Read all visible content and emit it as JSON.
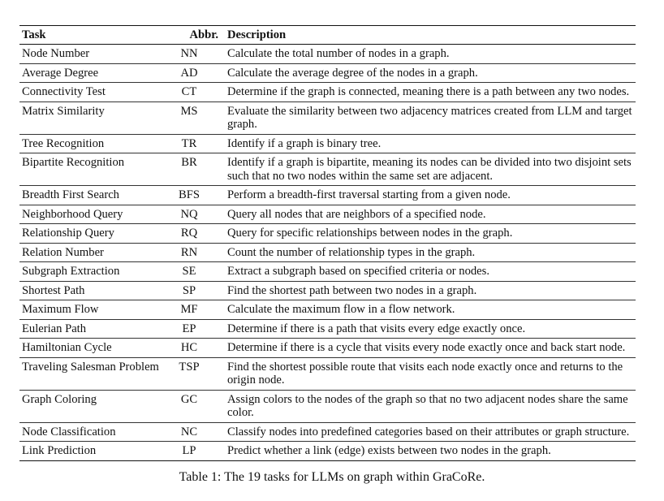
{
  "table": {
    "headers": {
      "task": "Task",
      "abbr": "Abbr.",
      "description": "Description"
    },
    "rows": [
      {
        "task": "Node Number",
        "abbr": "NN",
        "description": "Calculate the total number of nodes in a graph."
      },
      {
        "task": "Average Degree",
        "abbr": "AD",
        "description": "Calculate the average degree of the nodes in a graph."
      },
      {
        "task": "Connectivity Test",
        "abbr": "CT",
        "description": "Determine if the graph is connected, meaning there is a path between any two nodes."
      },
      {
        "task": "Matrix Similarity",
        "abbr": "MS",
        "description": "Evaluate the similarity between two adjacency matrices created from LLM and target graph."
      },
      {
        "task": "Tree Recognition",
        "abbr": "TR",
        "description": "Identify if a graph is binary tree."
      },
      {
        "task": "Bipartite Recognition",
        "abbr": "BR",
        "description": "Identify if a graph is bipartite, meaning its nodes can be divided into two disjoint sets such that no two nodes within the same set are adjacent."
      },
      {
        "task": "Breadth First Search",
        "abbr": "BFS",
        "description": "Perform a breadth-first traversal starting from a given node."
      },
      {
        "task": "Neighborhood Query",
        "abbr": "NQ",
        "description": "Query all nodes that are neighbors of a specified node."
      },
      {
        "task": "Relationship Query",
        "abbr": "RQ",
        "description": "Query for specific relationships between nodes in the graph."
      },
      {
        "task": "Relation Number",
        "abbr": "RN",
        "description": "Count the number of relationship types in the graph."
      },
      {
        "task": "Subgraph Extraction",
        "abbr": "SE",
        "description": "Extract a subgraph based on specified criteria or nodes."
      },
      {
        "task": "Shortest Path",
        "abbr": "SP",
        "description": "Find the shortest path between two nodes in a graph."
      },
      {
        "task": "Maximum Flow",
        "abbr": "MF",
        "description": "Calculate the maximum flow in a flow network."
      },
      {
        "task": "Eulerian Path",
        "abbr": "EP",
        "description": "Determine if there is a path that visits every edge exactly once."
      },
      {
        "task": "Hamiltonian Cycle",
        "abbr": "HC",
        "description": "Determine if there is a cycle that visits every node exactly once and back start node."
      },
      {
        "task": "Traveling Salesman Problem",
        "abbr": "TSP",
        "description": "Find the shortest possible route that visits each node exactly once and returns to the origin node."
      },
      {
        "task": "Graph Coloring",
        "abbr": "GC",
        "description": "Assign colors to the nodes of the graph so that no two adjacent nodes share the same color."
      },
      {
        "task": "Node Classification",
        "abbr": "NC",
        "description": "Classify nodes into predefined categories based on their attributes or graph structure."
      },
      {
        "task": "Link Prediction",
        "abbr": "LP",
        "description": "Predict whether a link (edge) exists between two nodes in the graph."
      }
    ]
  },
  "caption": "Table 1: The 19 tasks for LLMs on graph within GraCoRe."
}
